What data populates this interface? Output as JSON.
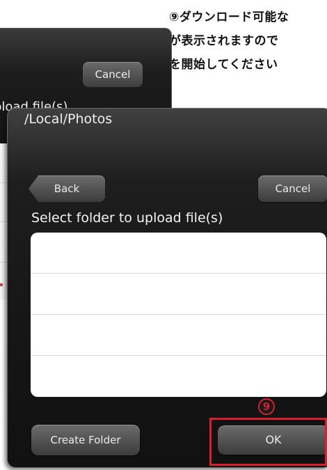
{
  "instruction": {
    "line1": "⑨ダウンロード可能な",
    "line2": "が表示されますので",
    "line3": "を開始してください"
  },
  "back_dialog": {
    "cancel_label": "Cancel",
    "caption": "pload file(s)"
  },
  "dialog": {
    "path_title": "/Local/Photos",
    "back_label": "Back",
    "cancel_label": "Cancel",
    "caption": "Select folder to upload file(s)",
    "folder_rows": [
      "",
      "",
      "",
      ""
    ],
    "create_folder_label": "Create Folder",
    "ok_label": "OK"
  },
  "annotation": {
    "step_number": "9",
    "highlight_color": "#d8202c"
  }
}
